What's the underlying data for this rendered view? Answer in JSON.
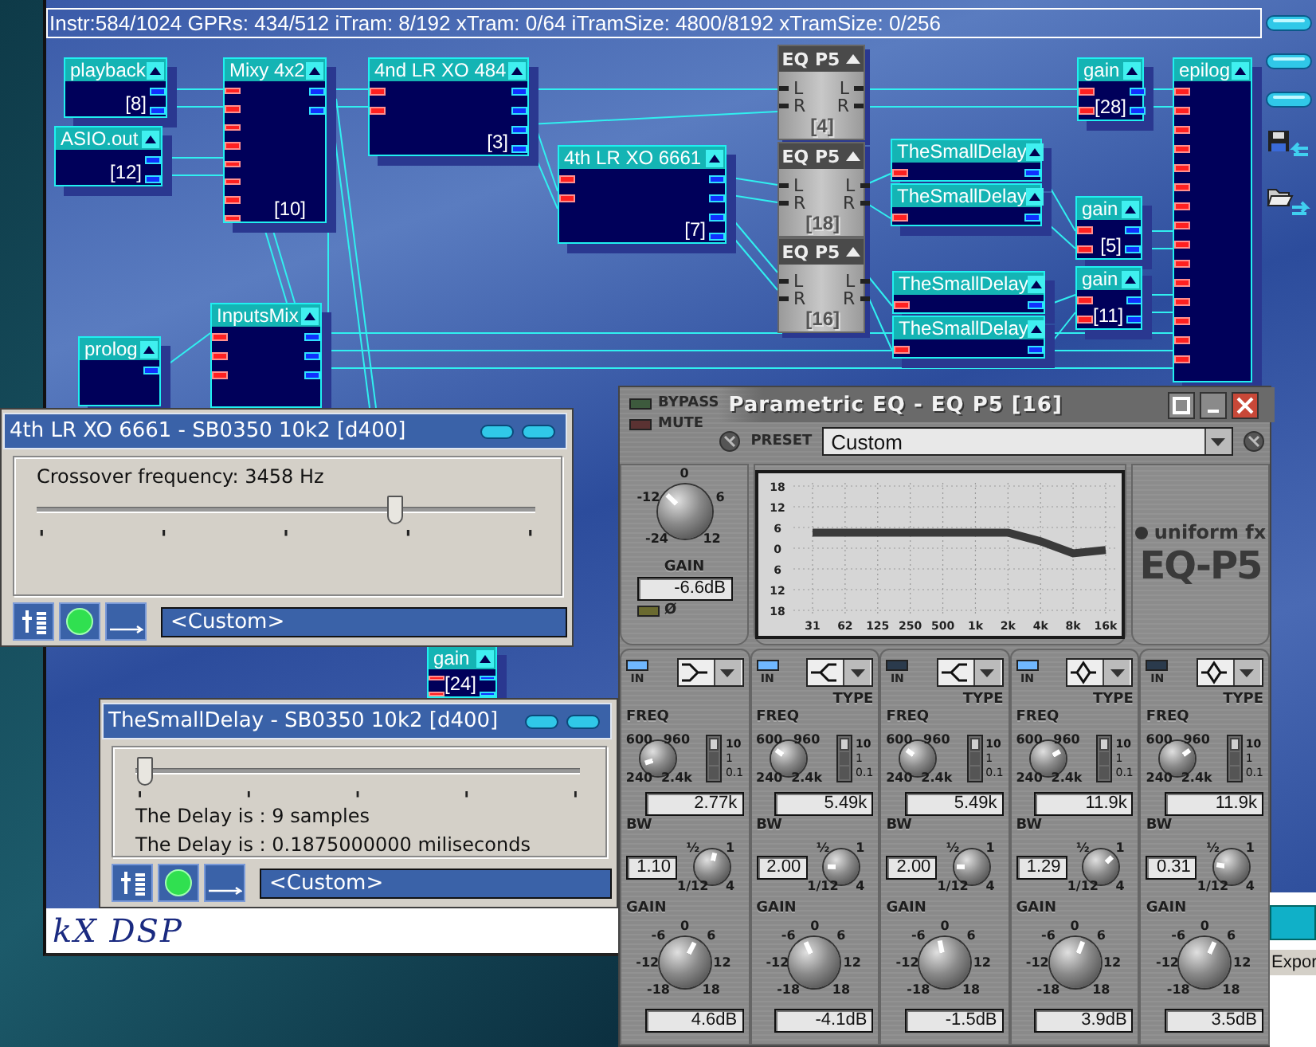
{
  "status_bar": "Instr:584/1024 GPRs: 434/512 iTram: 8/192 xTram: 0/64 iTramSize: 4800/8192 xTramSize: 0/256",
  "nodes": [
    {
      "kind": "blue",
      "title": "playback",
      "label": "[8]",
      "ports": [
        {
          "kind": "out"
        },
        {
          "kind": "out"
        }
      ]
    },
    {
      "kind": "blue",
      "title": "Mixy 4x2",
      "label": "[10]",
      "ports": [
        {
          "kind": "in"
        },
        {
          "kind": "in"
        },
        {
          "kind": "in"
        },
        {
          "kind": "in"
        },
        {
          "kind": "in"
        },
        {
          "kind": "in"
        },
        {
          "kind": "in"
        },
        {
          "kind": "in"
        },
        {
          "kind": "out"
        },
        {
          "kind": "out"
        }
      ]
    },
    {
      "kind": "blue",
      "title": "4nd LR XO 484",
      "label": "[3]",
      "ports": [
        {
          "kind": "in"
        },
        {
          "kind": "in"
        },
        {
          "kind": "out"
        },
        {
          "kind": "out"
        },
        {
          "kind": "out"
        },
        {
          "kind": "out"
        }
      ]
    },
    {
      "kind": "gray",
      "title": "EQ P5",
      "label": "[4]",
      "ports": [
        {
          "kind": "in",
          "label": "L"
        },
        {
          "kind": "in",
          "label": "R"
        },
        {
          "kind": "out",
          "label": "L"
        },
        {
          "kind": "out",
          "label": "R"
        }
      ]
    },
    {
      "kind": "blue",
      "title": "gain",
      "label": "[28]",
      "ports": [
        {
          "kind": "in"
        },
        {
          "kind": "in"
        },
        {
          "kind": "out"
        },
        {
          "kind": "out"
        }
      ]
    },
    {
      "kind": "blue",
      "title": "epilog",
      "ports": [
        {
          "kind": "in"
        },
        {
          "kind": "in"
        },
        {
          "kind": "in"
        },
        {
          "kind": "in"
        },
        {
          "kind": "in"
        },
        {
          "kind": "in"
        },
        {
          "kind": "in"
        },
        {
          "kind": "in"
        },
        {
          "kind": "in"
        },
        {
          "kind": "in"
        },
        {
          "kind": "in"
        },
        {
          "kind": "in"
        },
        {
          "kind": "in"
        },
        {
          "kind": "in"
        },
        {
          "kind": "in"
        }
      ]
    },
    {
      "kind": "blue",
      "title": "ASIO.out",
      "label": "[12]",
      "ports": [
        {
          "kind": "out"
        },
        {
          "kind": "out"
        }
      ]
    },
    {
      "kind": "blue",
      "title": "4th LR XO 6661",
      "label": "[7]",
      "ports": [
        {
          "kind": "in"
        },
        {
          "kind": "in"
        },
        {
          "kind": "out"
        },
        {
          "kind": "out"
        },
        {
          "kind": "out"
        },
        {
          "kind": "out"
        }
      ]
    },
    {
      "kind": "gray",
      "title": "EQ P5",
      "label": "[18]",
      "ports": [
        {
          "kind": "in",
          "label": "L"
        },
        {
          "kind": "in",
          "label": "R"
        },
        {
          "kind": "out",
          "label": "L"
        },
        {
          "kind": "out",
          "label": "R"
        }
      ]
    },
    {
      "kind": "blue",
      "title": "TheSmallDelay",
      "ports": [
        {
          "kind": "in"
        },
        {
          "kind": "out"
        }
      ]
    },
    {
      "kind": "blue",
      "title": "TheSmallDelay",
      "ports": [
        {
          "kind": "in"
        },
        {
          "kind": "out"
        }
      ]
    },
    {
      "kind": "blue",
      "title": "gain",
      "label": "[5]",
      "ports": [
        {
          "kind": "in"
        },
        {
          "kind": "in"
        },
        {
          "kind": "out"
        },
        {
          "kind": "out"
        }
      ]
    },
    {
      "kind": "gray",
      "title": "EQ P5",
      "label": "[16]",
      "ports": [
        {
          "kind": "in",
          "label": "L"
        },
        {
          "kind": "in",
          "label": "R"
        },
        {
          "kind": "out",
          "label": "L"
        },
        {
          "kind": "out",
          "label": "R"
        }
      ]
    },
    {
      "kind": "blue",
      "title": "TheSmallDelay",
      "ports": [
        {
          "kind": "in"
        },
        {
          "kind": "out"
        }
      ]
    },
    {
      "kind": "blue",
      "title": "gain",
      "label": "[11]",
      "ports": [
        {
          "kind": "in"
        },
        {
          "kind": "in"
        },
        {
          "kind": "out"
        },
        {
          "kind": "out"
        }
      ]
    },
    {
      "kind": "blue",
      "title": "TheSmallDelay",
      "ports": [
        {
          "kind": "in"
        },
        {
          "kind": "out"
        }
      ]
    },
    {
      "kind": "blue",
      "title": "InputsMix",
      "ports": [
        {
          "kind": "in"
        },
        {
          "kind": "in"
        },
        {
          "kind": "in"
        },
        {
          "kind": "out"
        },
        {
          "kind": "out"
        },
        {
          "kind": "out"
        }
      ]
    },
    {
      "kind": "blue",
      "title": "prolog",
      "ports": [
        {
          "kind": "out"
        }
      ]
    },
    {
      "kind": "blue",
      "title": "gain",
      "label": "[24]",
      "ports": [
        {
          "kind": "in"
        },
        {
          "kind": "in"
        },
        {
          "kind": "out"
        },
        {
          "kind": "out"
        }
      ]
    }
  ],
  "windows": [
    {
      "title": "4th LR XO 6661 - SB0350 10k2 [d400]",
      "items": [
        {
          "kind": "text",
          "text": "Crossover frequency: 3458 Hz"
        },
        {
          "kind": "slider",
          "level": 0.72
        }
      ],
      "preset": "<Custom>"
    },
    {
      "title": "TheSmallDelay - SB0350 10k2 [d400]",
      "items": [
        {
          "kind": "slider",
          "level": 0.02
        },
        {
          "kind": "text",
          "text": "The Delay is : 9 samples"
        },
        {
          "kind": "text",
          "text": "The Delay is : 0.1875000000 miliseconds"
        }
      ],
      "preset": "<Custom>"
    }
  ],
  "eq": {
    "title": "Parametric EQ - EQ P5 [16]",
    "bypass": {
      "label": "BYPASS",
      "on": false
    },
    "mute": {
      "label": "MUTE",
      "on": false
    },
    "preset_label": "PRESET",
    "preset": "Custom",
    "gain": {
      "label": "GAIN",
      "scale": [
        "0",
        "-12",
        "6",
        "-24",
        "12"
      ],
      "level": 0.33,
      "value": "-6.6dB"
    },
    "phase": {
      "label": "Ø",
      "on": false
    },
    "graph": {
      "chart_data": {
        "type": "line",
        "grid": true,
        "categories": [
          "31",
          "62",
          "125",
          "250",
          "500",
          "1k",
          "2k",
          "4k",
          "8k",
          "16k"
        ],
        "series": [
          {
            "color": "#3a3a3a",
            "values": [
              4.5,
              4.5,
              4.5,
              4.5,
              4.5,
              4.5,
              4.5,
              2,
              -1.5,
              -0.5
            ]
          }
        ],
        "ylim": [
          -18,
          18
        ],
        "yticks": [
          {
            "value": 18,
            "label": "18"
          },
          {
            "value": 12,
            "label": "12"
          },
          {
            "value": 6,
            "label": "6"
          },
          {
            "value": 0,
            "label": "0"
          },
          {
            "value": -6,
            "label": "6"
          },
          {
            "value": -12,
            "label": "12"
          },
          {
            "value": -18,
            "label": "18"
          }
        ]
      }
    },
    "logo": {
      "brand": "uniform fx",
      "product": "EQ-P5"
    },
    "bands": [
      {
        "in": {
          "label": "IN",
          "on": true
        },
        "kind": "shelf-right",
        "freq": {
          "label": "FREQ",
          "scale": [
            "600",
            "960",
            "240",
            "2.4k"
          ],
          "level": 0.1,
          "value": "2.77k"
        },
        "range": [
          {
            "label": "10",
            "selected": true
          },
          {
            "label": "1",
            "selected": false
          },
          {
            "label": "0.1",
            "selected": false
          }
        ],
        "bw": {
          "label": "BW",
          "value": "1.10",
          "scale": [
            "½",
            "1",
            "1/12",
            "4"
          ],
          "level": 0.55
        },
        "gain": {
          "label": "GAIN",
          "scale": [
            "0",
            "-6",
            "6",
            "-12",
            "12",
            "-18",
            "18"
          ],
          "level": 0.6,
          "value": "4.6dB"
        }
      },
      {
        "in": {
          "label": "IN",
          "on": true
        },
        "kind": "shelf-left",
        "type_label": "TYPE",
        "freq": {
          "label": "FREQ",
          "scale": [
            "600",
            "960",
            "240",
            "2.4k"
          ],
          "level": 0.3,
          "value": "5.49k"
        },
        "range": [
          {
            "label": "10",
            "selected": true
          },
          {
            "label": "1",
            "selected": false
          },
          {
            "label": "0.1",
            "selected": false
          }
        ],
        "bw": {
          "label": "BW",
          "value": "2.00",
          "scale": [
            "½",
            "1",
            "1/12",
            "4"
          ],
          "level": 0.17
        },
        "gain": {
          "label": "GAIN",
          "scale": [
            "0",
            "-6",
            "6",
            "-12",
            "12",
            "-18",
            "18"
          ],
          "level": 0.41,
          "value": "-4.1dB"
        }
      },
      {
        "in": {
          "label": "IN",
          "on": false
        },
        "kind": "shelf-left",
        "type_label": "TYPE",
        "freq": {
          "label": "FREQ",
          "scale": [
            "600",
            "960",
            "240",
            "2.4k"
          ],
          "level": 0.3,
          "value": "5.49k"
        },
        "range": [
          {
            "label": "10",
            "selected": true
          },
          {
            "label": "1",
            "selected": false
          },
          {
            "label": "0.1",
            "selected": false
          }
        ],
        "bw": {
          "label": "BW",
          "value": "2.00",
          "scale": [
            "½",
            "1",
            "1/12",
            "4"
          ],
          "level": 0.17
        },
        "gain": {
          "label": "GAIN",
          "scale": [
            "0",
            "-6",
            "6",
            "-12",
            "12",
            "-18",
            "18"
          ],
          "level": 0.46,
          "value": "-1.5dB"
        }
      },
      {
        "in": {
          "label": "IN",
          "on": true
        },
        "kind": "peak",
        "type_label": "TYPE",
        "freq": {
          "label": "FREQ",
          "scale": [
            "600",
            "960",
            "240",
            "2.4k"
          ],
          "level": 0.72,
          "value": "11.9k"
        },
        "range": [
          {
            "label": "10",
            "selected": true
          },
          {
            "label": "1",
            "selected": false
          },
          {
            "label": "0.1",
            "selected": false
          }
        ],
        "bw": {
          "label": "BW",
          "value": "1.29",
          "scale": [
            "½",
            "1",
            "1/12",
            "4"
          ],
          "level": 0.67
        },
        "gain": {
          "label": "GAIN",
          "scale": [
            "0",
            "-6",
            "6",
            "-12",
            "12",
            "-18",
            "18"
          ],
          "level": 0.58,
          "value": "3.9dB"
        }
      },
      {
        "in": {
          "label": "IN",
          "on": false
        },
        "kind": "peak",
        "type_label": "TYPE",
        "freq": {
          "label": "FREQ",
          "scale": [
            "600",
            "960",
            "240",
            "2.4k"
          ],
          "level": 0.7,
          "value": "11.9k"
        },
        "range": [
          {
            "label": "10",
            "selected": true
          },
          {
            "label": "1",
            "selected": false
          },
          {
            "label": "0.1",
            "selected": false
          }
        ],
        "bw": {
          "label": "BW",
          "value": "0.31",
          "scale": [
            "½",
            "1",
            "1/12",
            "4"
          ],
          "level": 0.2
        },
        "gain": {
          "label": "GAIN",
          "scale": [
            "0",
            "-6",
            "6",
            "-12",
            "12",
            "-18",
            "18"
          ],
          "level": 0.59,
          "value": "3.5dB"
        }
      }
    ]
  },
  "logo": "kX DSP",
  "export_button": "Expor"
}
